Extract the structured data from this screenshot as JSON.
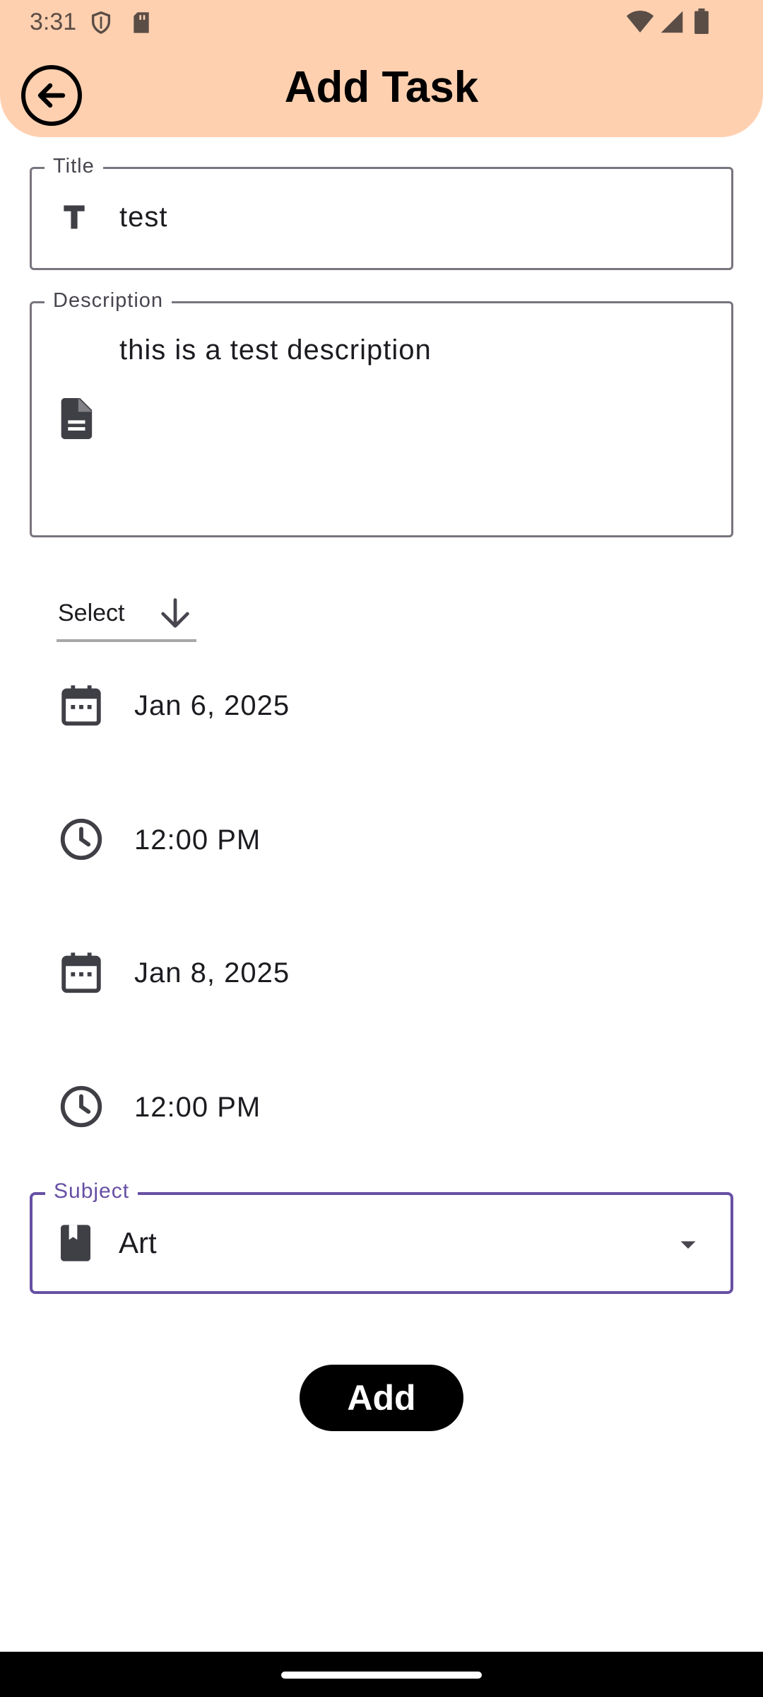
{
  "status": {
    "time": "3:31"
  },
  "header": {
    "title": "Add Task"
  },
  "form": {
    "title_label": "Title",
    "title_value": "test",
    "description_label": "Description",
    "description_value": "this is a test description",
    "select_label": "Select",
    "start_date": "Jan 6, 2025",
    "start_time": "12:00 PM",
    "end_date": "Jan 8, 2025",
    "end_time": "12:00 PM",
    "subject_label": "Subject",
    "subject_value": "Art",
    "add_label": "Add"
  },
  "colors": {
    "header_bg": "#ffd0b0",
    "accent": "#6750a4",
    "button_bg": "#000000"
  }
}
